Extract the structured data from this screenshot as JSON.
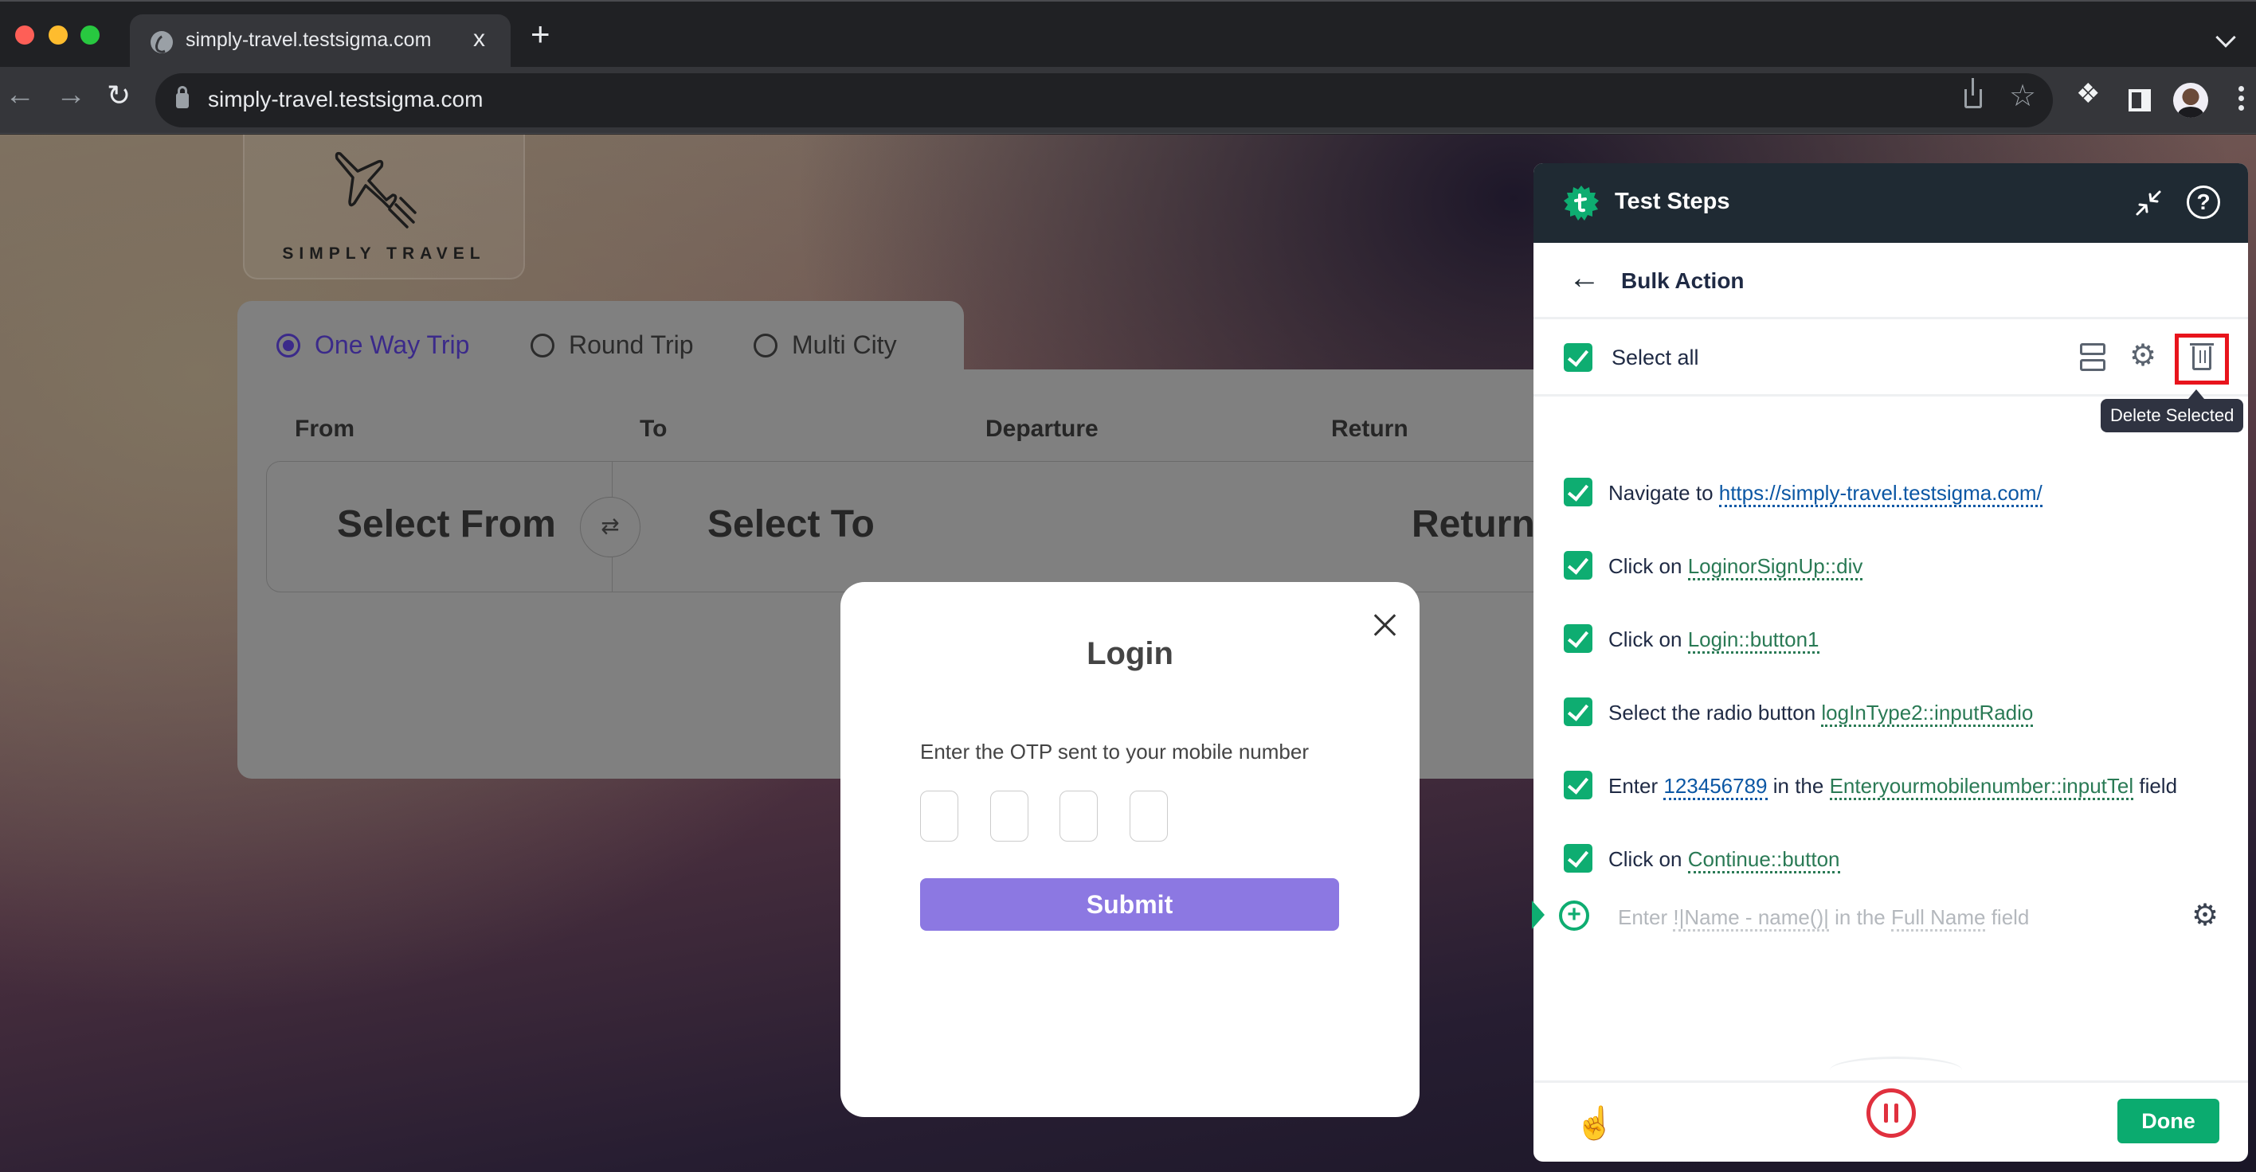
{
  "browser": {
    "tab_title": "simply-travel.testsigma.com",
    "tab_close": "x",
    "new_tab": "+",
    "url": "simply-travel.testsigma.com",
    "icons": {
      "back": "←",
      "forward": "→",
      "reload": "↻",
      "star": "☆",
      "extensions": "puzzle-icon"
    }
  },
  "site": {
    "brand": "SIMPLY TRAVEL",
    "trip_types": [
      {
        "label": "One Way Trip",
        "selected": true
      },
      {
        "label": "Round Trip",
        "selected": false
      },
      {
        "label": "Multi City",
        "selected": false
      }
    ],
    "fields": {
      "from_label": "From",
      "to_label": "To",
      "departure_label": "Departure",
      "return_label": "Return",
      "from_value": "Select From",
      "to_value": "Select To",
      "return_value": "Return"
    },
    "swap_icon": "⇄"
  },
  "login_modal": {
    "title": "Login",
    "prompt": "Enter the OTP sent to your mobile number",
    "otp_values": [
      "",
      "",
      "",
      ""
    ],
    "submit_label": "Submit"
  },
  "test_steps_panel": {
    "title": "Test Steps",
    "help_icon": "?",
    "bulk_action_title": "Bulk Action",
    "back_icon": "←",
    "select_all_label": "Select all",
    "select_all_checked": true,
    "tooltip": "Delete Selected",
    "gear_icon": "⚙",
    "steps": [
      {
        "checked": true,
        "prefix": "Navigate to ",
        "token1": "https://simply-travel.testsigma.com/",
        "token1_kind": "blue"
      },
      {
        "checked": true,
        "prefix": "Click on ",
        "token1": "LoginorSignUp::div",
        "token1_kind": "green"
      },
      {
        "checked": true,
        "prefix": "Click on ",
        "token1": "Login::button1",
        "token1_kind": "green"
      },
      {
        "checked": true,
        "prefix": "Select the radio button ",
        "token1": "logInType2::inputRadio",
        "token1_kind": "green"
      },
      {
        "checked": true,
        "prefix": "Enter ",
        "token1": "123456789",
        "token1_kind": "blue",
        "middle": " in the ",
        "token2": "Enteryourmobilenumber::inputTel",
        "token2_kind": "green",
        "suffix": " field"
      },
      {
        "checked": true,
        "prefix": "Click on ",
        "token1": "Continue::button",
        "token1_kind": "green"
      }
    ],
    "new_step": {
      "add_icon": "+",
      "prefix": "Enter ",
      "token1": "!|Name - name()|",
      "middle": " in the ",
      "token2": "Full Name",
      "suffix": " field"
    },
    "footer": {
      "pointer_icon": "☝",
      "done_label": "Done"
    },
    "colors": {
      "accent_green": "#0ead71",
      "header_bg": "#1f2a33",
      "highlight_red": "#e8141c",
      "pause_red": "#e0303e"
    }
  }
}
